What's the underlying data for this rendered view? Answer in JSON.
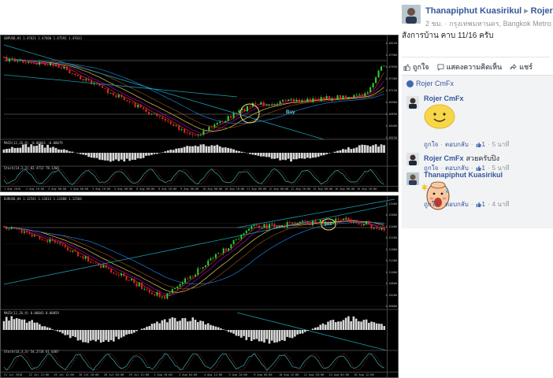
{
  "charts": {
    "top": {
      "symbol": "GBPUSD,H1  1.47621 1.47660 1.47592 1.47633",
      "osma_label": "MACD(12,26,9) -0.00041 -0.00079",
      "stoch_label": "Stoch(14,3,3) 82.4712 78.1204",
      "price_ticks": [
        "1.48150",
        "1.47900",
        "1.47650",
        "1.47400",
        "1.47150",
        "1.46900",
        "1.46650",
        "1.46400",
        "1.46150"
      ],
      "date_ticks": [
        "1 Aug 2016",
        "2 Aug 16:00",
        "3 Aug 08:00",
        "4 Aug 00:00",
        "4 Aug 16:00",
        "5 Aug 08:00",
        "8 Aug 00:00",
        "8 Aug 16:00",
        "9 Aug 08:00",
        "10 Aug 00:00",
        "10 Aug 16:00",
        "11 Aug 08:00",
        "12 Aug 00:00",
        "12 Aug 16:00",
        "15 Aug 08:00",
        "16 Aug 00:00",
        "16 Aug 16:00"
      ],
      "marker": "Buy"
    },
    "bottom": {
      "symbol": "EURUSD,H4  1.12541 1.12612 1.12480 1.12566",
      "osma_label": "MACD(12,26,9) 0.00043 0.00059",
      "stoch_label": "Stoch(14,3,3) 54.2718 61.0387",
      "price_ticks": [
        "1.13400",
        "1.13000",
        "1.12600",
        "1.12200",
        "1.11800",
        "1.11400",
        "1.11000",
        "1.10600",
        "1.10200",
        "1.09800"
      ],
      "date_ticks": [
        "21 Jul 2016",
        "22 Jul 12:00",
        "25 Jul 12:00",
        "26 Jul 20:00",
        "28 Jul 04:00",
        "29 Jul 12:00",
        "1 Aug 20:00",
        "3 Aug 04:00",
        "4 Aug 12:00",
        "5 Aug 20:00",
        "9 Aug 04:00",
        "10 Aug 12:00",
        "11 Aug 20:00",
        "15 Aug 04:00",
        "16 Aug 12:00"
      ],
      "marker": "Sell"
    }
  },
  "post": {
    "author": "Thanapiphut Kuasirikul",
    "target": "Rojer CmFx",
    "time": "2 ชม.",
    "location": "กรุงเทพมหานคร, Bangkok Metropolis",
    "text": "สังการบ้าน คาบ 11/16 ครับ",
    "actions": {
      "like": "ถูกใจ",
      "comment": "แสดงความคิดเห็น",
      "share": "แชร์"
    },
    "shared_by": "Rojer CmFx",
    "comments": [
      {
        "name": "Rojer CmFx",
        "text": "",
        "reply": "ตอบกลับ",
        "like": "ถูกใจ",
        "likes": "1",
        "time": "5 นาที"
      },
      {
        "name": "Rojer CmFx",
        "text": "สวยครับปิง",
        "reply": "ตอบกลับ",
        "like": "ถูกใจ",
        "likes": "1",
        "time": "5 นาที"
      },
      {
        "name": "Thanapiphut Kuasirikul",
        "text": "",
        "reply": "ตอบกลับ",
        "like": "ถูกใจ",
        "likes": "1",
        "time": "4 นาที"
      }
    ]
  },
  "colors": {
    "link": "#365899",
    "muted": "#90949c",
    "candle_up": "#2fd12f",
    "candle_down": "#e02424",
    "trend_line": "#1a9bb0"
  }
}
